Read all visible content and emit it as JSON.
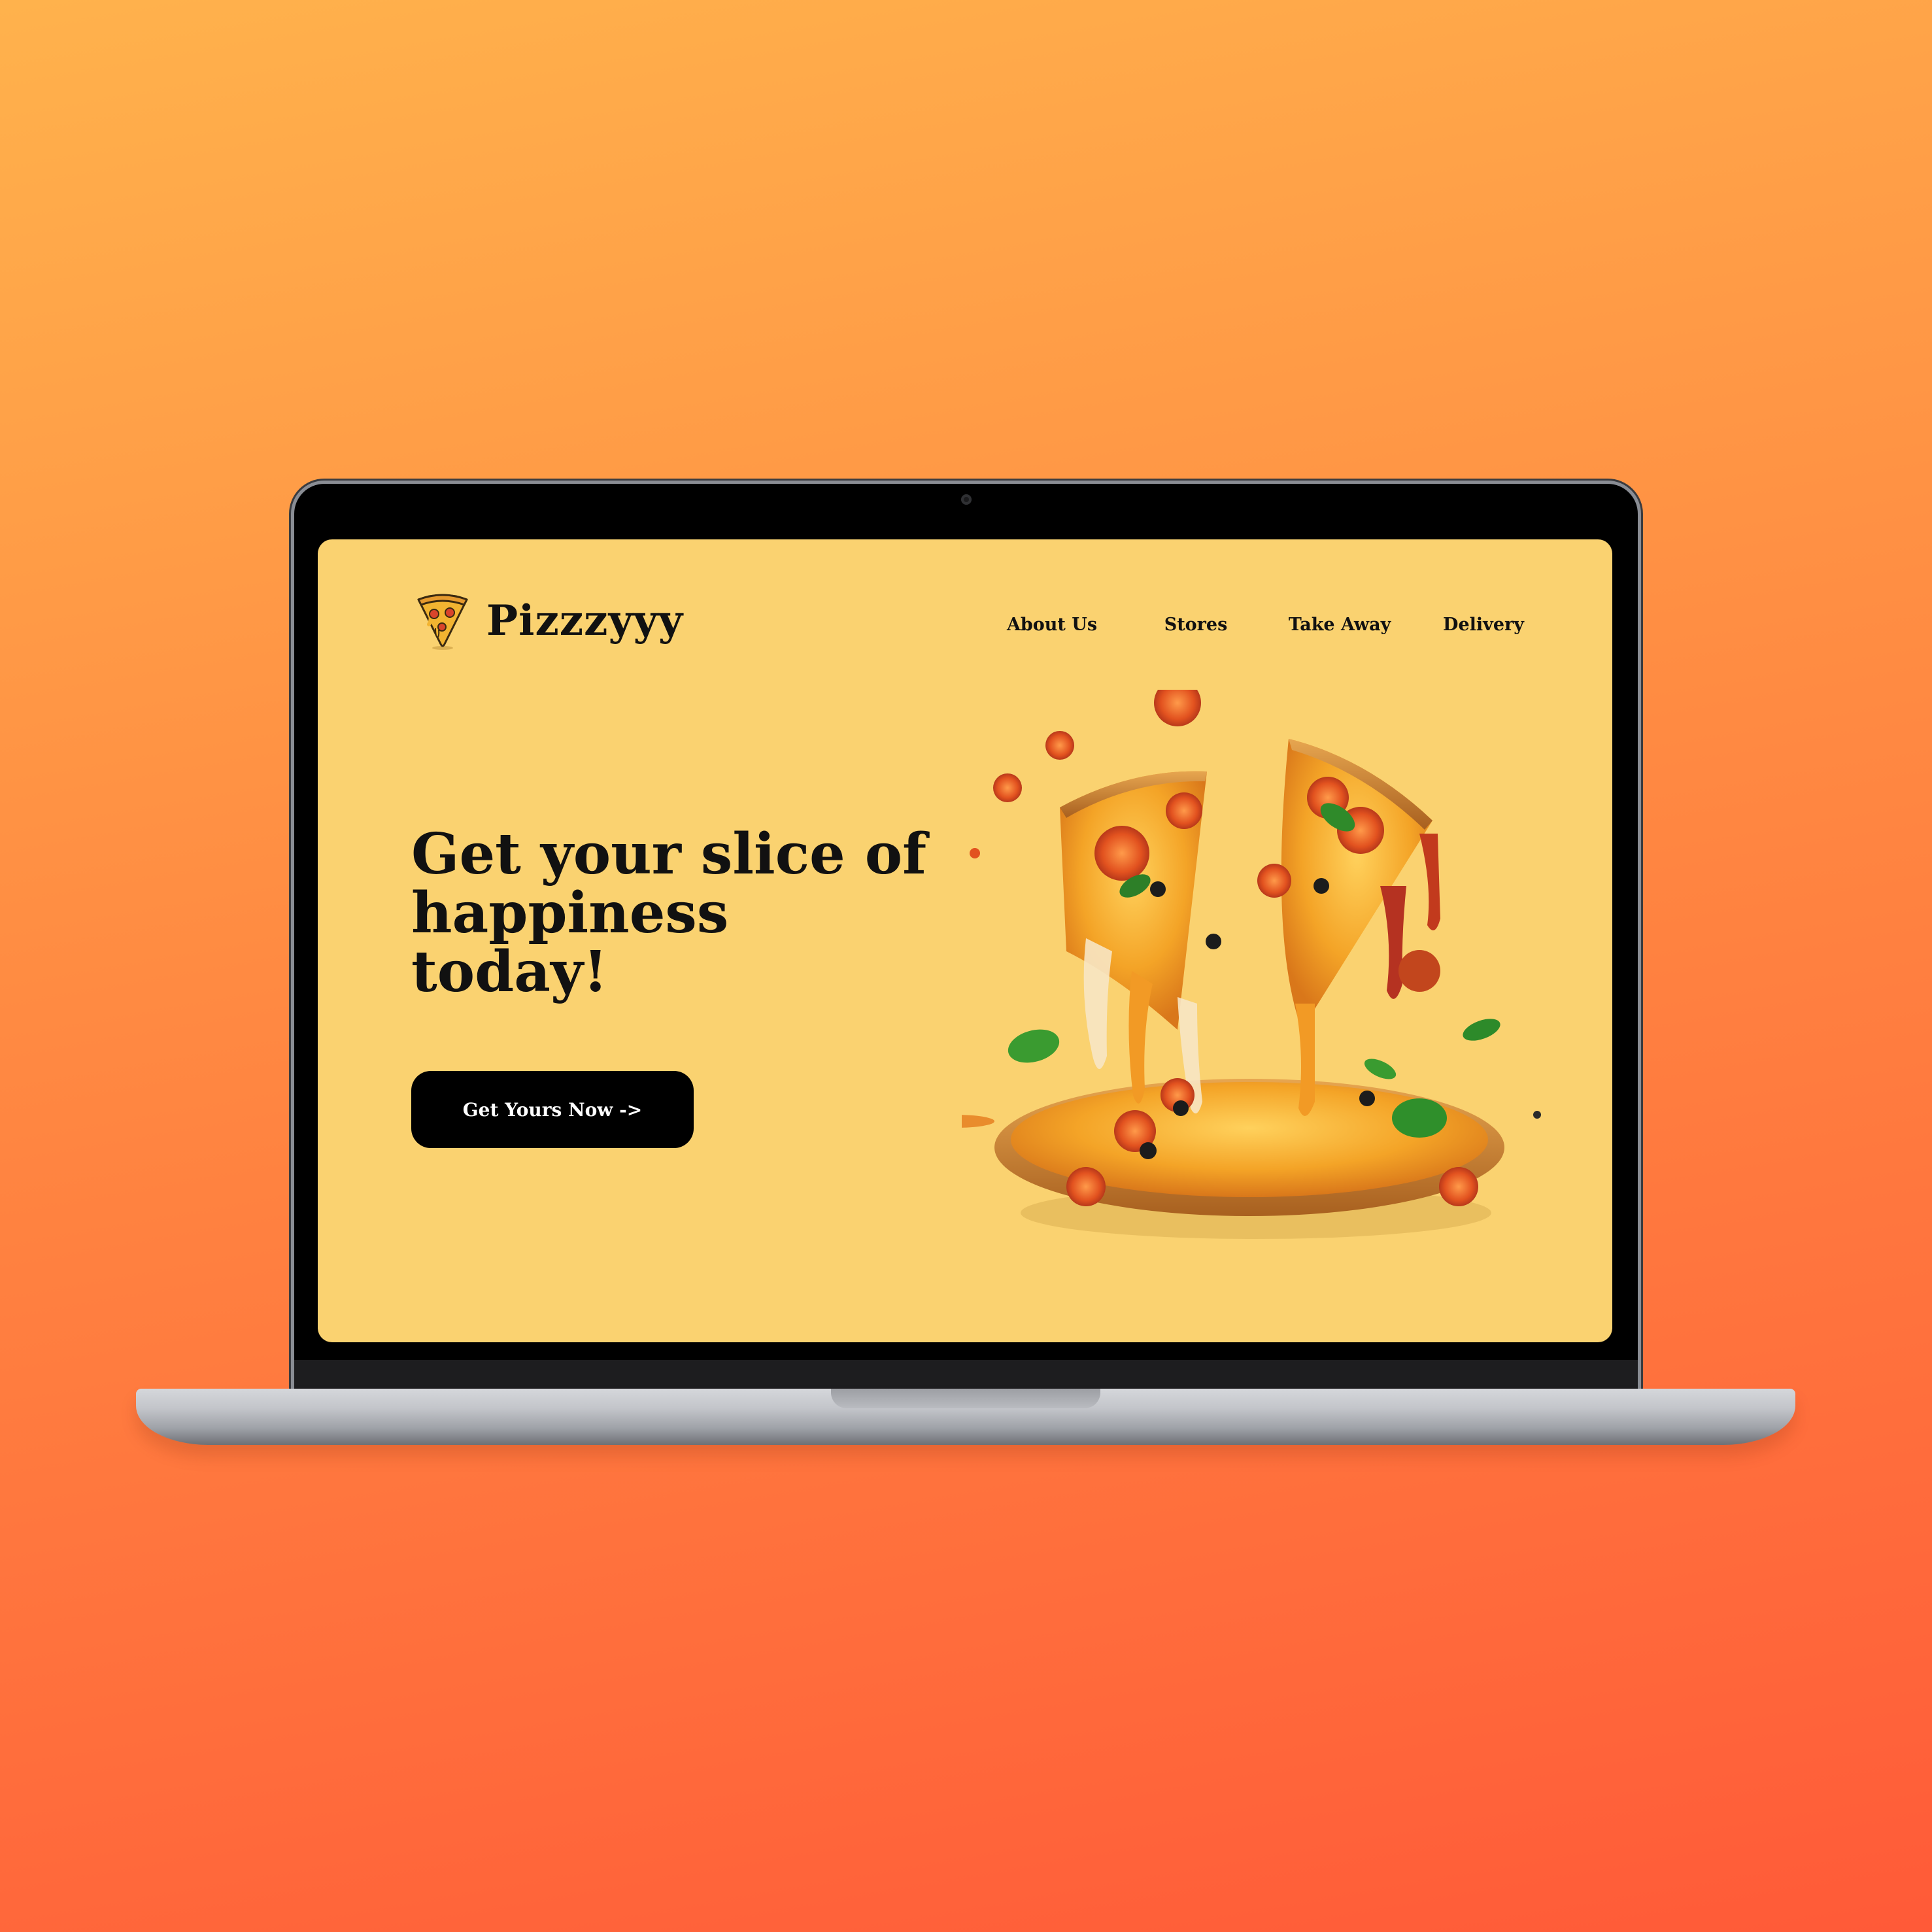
{
  "brand": {
    "name": "Pizzzyyy",
    "logo_icon": "pizza-slice-icon"
  },
  "nav": {
    "items": [
      {
        "label": "About Us"
      },
      {
        "label": "Stores"
      },
      {
        "label": "Take Away"
      },
      {
        "label": "Delivery"
      }
    ]
  },
  "hero": {
    "headline_lines": [
      "Get your slice of",
      "happiness",
      "today!"
    ],
    "cta_label": "Get Yours Now ->",
    "image": "melting-pizza-image"
  },
  "colors": {
    "page_gradient_top": "#ffb24c",
    "page_gradient_bottom": "#ff5a38",
    "screen_background": "#fad270",
    "cta_background": "#000000",
    "cta_text": "#ffffff",
    "text": "#111111"
  }
}
